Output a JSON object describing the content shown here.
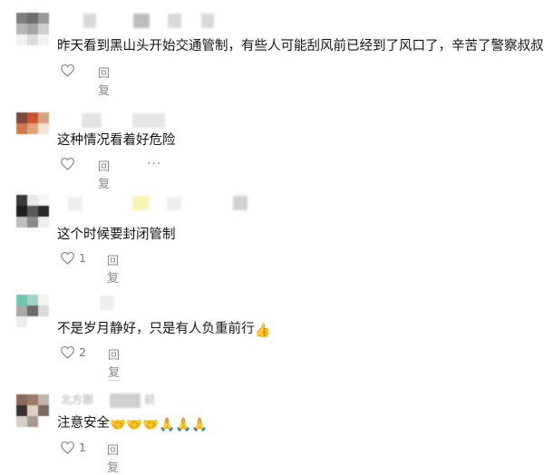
{
  "comments": [
    {
      "text": "昨天看到黑山头开始交通管制，有些人可能刮风前已经到了风口了，辛苦了警察叔叔",
      "emoji": "🙏",
      "like_count": "",
      "reply_label": "回复"
    },
    {
      "text": "这种情况看着好危险",
      "emoji": "",
      "like_count": "",
      "reply_label": "回复",
      "more_label": "···"
    },
    {
      "text": "这个时候要封闭管制",
      "emoji": "",
      "like_count": "1",
      "reply_label": "回复"
    },
    {
      "text": "不是岁月静好，只是有人负重前行",
      "emoji": "👍",
      "like_count": "2",
      "reply_label": "回复"
    },
    {
      "username": "北方跟",
      "timestamp": "前",
      "text": "注意安全",
      "emoji": "🤝🤝🤝🙏🙏🙏",
      "like_count": "1",
      "reply_label": "回复"
    }
  ],
  "icons": {
    "like": "heart-outline-icon",
    "more": "more-dots-icon"
  },
  "colors": {
    "text": "#141414",
    "meta": "#8a8a8a",
    "background": "#ffffff"
  }
}
